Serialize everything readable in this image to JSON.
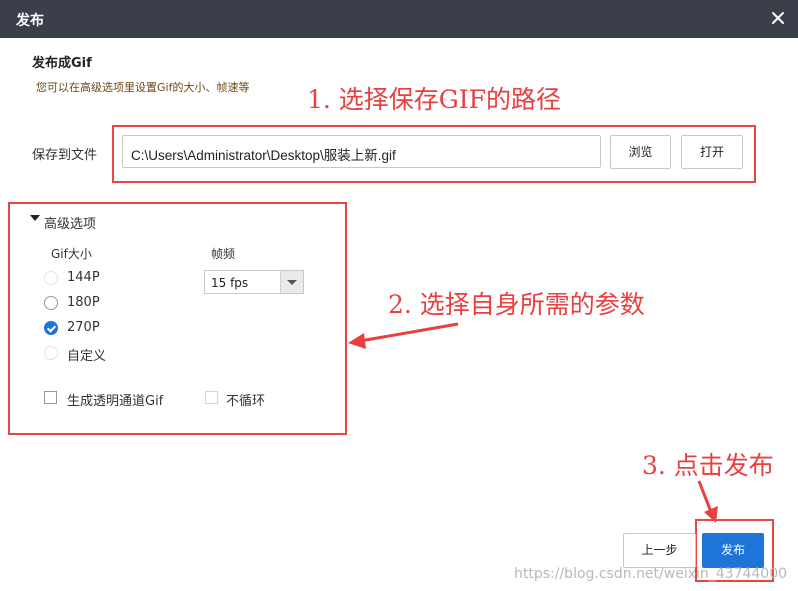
{
  "window": {
    "title": "发布"
  },
  "header": {
    "title": "发布成Gif",
    "hint": "您可以在高级选项里设置Gif的大小、帧速等"
  },
  "save": {
    "label": "保存到文件",
    "path": "C:\\Users\\Administrator\\Desktop\\服装上新.gif",
    "browse_label": "浏览",
    "open_label": "打开"
  },
  "advanced": {
    "label": "高级选项",
    "size_label": "Gif大小",
    "sizes": [
      {
        "label": "144P",
        "selected": false
      },
      {
        "label": "180P",
        "selected": false
      },
      {
        "label": "270P",
        "selected": true
      },
      {
        "label": "自定义",
        "selected": false
      }
    ],
    "fps_label": "帧频",
    "fps_value": "15 fps",
    "transparent_label": "生成透明通道Gif",
    "transparent_checked": false,
    "noloop_label": "不循环",
    "noloop_checked": false
  },
  "annotations": {
    "a1": "1. 选择保存GIF的路径",
    "a2": "2. 选择自身所需的参数",
    "a3": "3. 点击发布"
  },
  "footer": {
    "prev_label": "上一步",
    "publish_label": "发布"
  },
  "watermark": "https://blog.csdn.net/weixin_43744000",
  "colors": {
    "titlebar": "#3b3f4a",
    "accent": "#1e74d8",
    "annotation": "#ea3f3f"
  }
}
